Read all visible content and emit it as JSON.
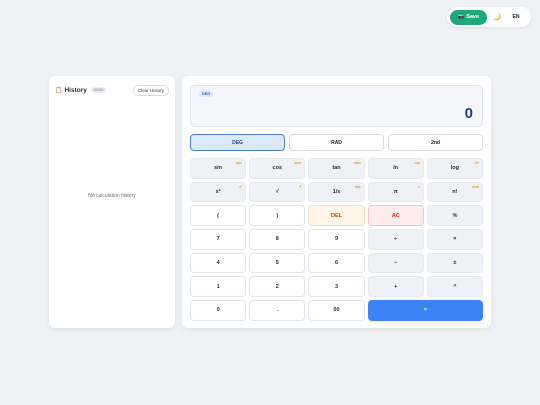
{
  "toolbar": {
    "save_label": "Save",
    "save_icon": "📷",
    "theme_icon": "🌙",
    "lang_label": "EN"
  },
  "history": {
    "icon": "📋",
    "title": "History",
    "count": "0/100",
    "clear_label": "Clear History",
    "empty_text": "No calculation history"
  },
  "display": {
    "angle_badge": "DEG",
    "value": "0"
  },
  "modes": [
    "DEG",
    "RAD",
    "2nd"
  ],
  "keys": [
    {
      "label": "sin",
      "sup": "asin",
      "kind": "fn"
    },
    {
      "label": "cos",
      "sup": "acos",
      "kind": "fn"
    },
    {
      "label": "tan",
      "sup": "atan",
      "kind": "fn"
    },
    {
      "label": "ln",
      "sup": "exp",
      "kind": "fn"
    },
    {
      "label": "log",
      "sup": "10ˣ",
      "kind": "fn"
    },
    {
      "label": "x²",
      "sup": "x³",
      "kind": "fn"
    },
    {
      "label": "√",
      "sup": "∛",
      "kind": "fn"
    },
    {
      "label": "1/x",
      "sup": "abs",
      "kind": "fn"
    },
    {
      "label": "π",
      "sup": "e",
      "kind": "fn"
    },
    {
      "label": "n!",
      "sup": "mod",
      "kind": "fn"
    },
    {
      "label": "(",
      "sup": "",
      "kind": "num"
    },
    {
      "label": ")",
      "sup": "",
      "kind": "num"
    },
    {
      "label": "DEL",
      "sup": "",
      "kind": "del"
    },
    {
      "label": "AC",
      "sup": "",
      "kind": "ac"
    },
    {
      "label": "%",
      "sup": "",
      "kind": "op"
    },
    {
      "label": "7",
      "sup": "",
      "kind": "num"
    },
    {
      "label": "8",
      "sup": "",
      "kind": "num"
    },
    {
      "label": "9",
      "sup": "",
      "kind": "num"
    },
    {
      "label": "÷",
      "sup": "",
      "kind": "op"
    },
    {
      "label": "×",
      "sup": "",
      "kind": "op"
    },
    {
      "label": "4",
      "sup": "",
      "kind": "num"
    },
    {
      "label": "5",
      "sup": "",
      "kind": "num"
    },
    {
      "label": "6",
      "sup": "",
      "kind": "num"
    },
    {
      "label": "−",
      "sup": "",
      "kind": "op"
    },
    {
      "label": "±",
      "sup": "",
      "kind": "op"
    },
    {
      "label": "1",
      "sup": "",
      "kind": "num"
    },
    {
      "label": "2",
      "sup": "",
      "kind": "num"
    },
    {
      "label": "3",
      "sup": "",
      "kind": "num"
    },
    {
      "label": "+",
      "sup": "",
      "kind": "op"
    },
    {
      "label": "^",
      "sup": "",
      "kind": "op"
    },
    {
      "label": "0",
      "sup": "",
      "kind": "num"
    },
    {
      "label": ".",
      "sup": "",
      "kind": "num"
    },
    {
      "label": "00",
      "sup": "",
      "kind": "num"
    },
    {
      "label": "=",
      "sup": "",
      "kind": "eq"
    }
  ],
  "colors": {
    "accent": "#3b82f6",
    "save": "#1fa97a",
    "function_sup": "#e29a1a"
  }
}
